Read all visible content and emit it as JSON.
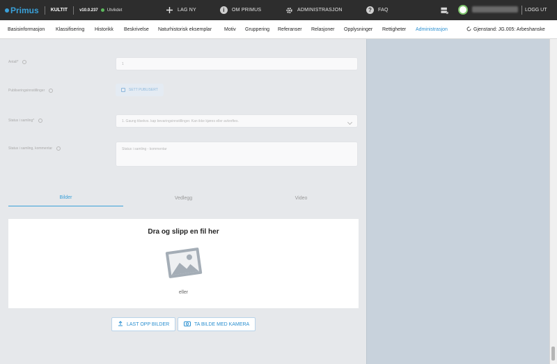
{
  "header": {
    "logo_text": "Primus",
    "org": "KULTIT",
    "version": "v10.0.237",
    "env": "Utvikdet",
    "nav": {
      "new": "LAG NY",
      "about": "OM PRIMUS",
      "admin": "ADMINISTRASJON",
      "faq": "FAQ"
    },
    "logout": "LOGG UT"
  },
  "tabs": [
    "Basisinformasjon",
    "Klassifisering",
    "Historikk",
    "Beskrivelse",
    "Naturhistorisk eksemplar",
    "Motiv",
    "Gruppering",
    "Referanser",
    "Relasjoner",
    "Opplysninger",
    "Rettigheter",
    "Administrasjon"
  ],
  "active_tab": "Administrasjon",
  "object_label": "Gjenstand: JG.005: Arbeshanske",
  "form": {
    "count_label": "Antall*",
    "count_value": "1",
    "publish_label": "Publiseringsinnstillinger",
    "publish_button": "SETT PUBLISERT",
    "status_label": "Status i samling*",
    "status_value": "1. Gaung tilsekvs. kap bevaringsinnstillinger. Kan ikke kjøres eller avkreftes.",
    "comment_label": "Status i samling, kommentar",
    "comment_placeholder": "Status i samling - kommentar"
  },
  "media_tabs": [
    "Bilder",
    "Vedlegg",
    "Video"
  ],
  "active_media_tab": "Bilder",
  "dropzone": {
    "title": "Dra og slipp en fil her",
    "or": "eller"
  },
  "buttons": {
    "upload": "LAST OPP BILDER",
    "camera": "TA BILDE MED KAMERA"
  },
  "icons": [
    "plus-icon",
    "info-icon",
    "gear-icon",
    "help-icon",
    "server-icon",
    "user-avatar",
    "refresh-icon",
    "image-placeholder-icon",
    "upload-icon",
    "camera-icon",
    "edit-icon",
    "chevron-down-icon"
  ]
}
